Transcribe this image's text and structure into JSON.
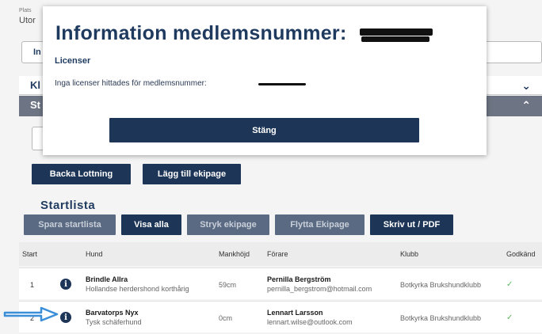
{
  "background": {
    "header_small": "Plats",
    "header_label": "Utor",
    "tab_in_label": "In",
    "accordion_kl_label": "Kl",
    "accordion_st_label": "St"
  },
  "actions": {
    "back_label": "Backa Lottning",
    "add_label": "Lägg till ekipage"
  },
  "startlist": {
    "title": "Startlista",
    "buttons": {
      "save": "Spara startlista",
      "show_all": "Visa alla",
      "strike": "Stryk ekipage",
      "move": "Flytta Ekipage",
      "print": "Skriv ut / PDF"
    },
    "columns": [
      "Start",
      "Hund",
      "Mankhöjd",
      "Förare",
      "Klubb",
      "Godkänd"
    ],
    "rows": [
      {
        "start": "1",
        "dog_name": "Brindle Allra",
        "dog_breed": "Hollandse herdershond korthårig",
        "height": "59cm",
        "handler_name": "Pernilla Bergström",
        "handler_email": "pernilla_bergstrom@hotmail.com",
        "club": "Botkyrka Brukshundklubb",
        "approved": "✓"
      },
      {
        "start": "2",
        "dog_name": "Barvatorps Nyx",
        "dog_breed": "Tysk schäferhund",
        "height": "0cm",
        "handler_name": "Lennart Larsson",
        "handler_email": "lennart.wilse@outlook.com",
        "club": "Botkyrka Brukshundklubb",
        "approved": "✓"
      }
    ]
  },
  "modal": {
    "title": "Information medlemsnummer:",
    "section": "Licenser",
    "message": "Inga licenser hittades för medlemsnummer:",
    "close_label": "Stäng"
  },
  "colors": {
    "primary": "#1d3557",
    "heading": "#1f3a5f",
    "check": "#5cb85c",
    "arrow": "#3b8fd9"
  }
}
